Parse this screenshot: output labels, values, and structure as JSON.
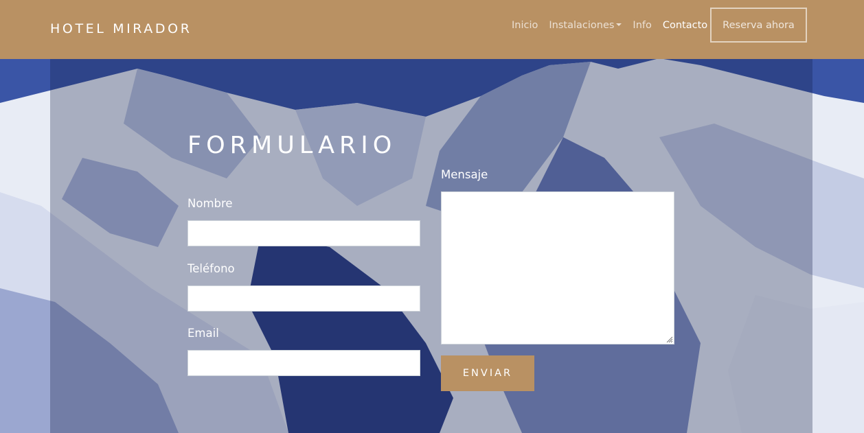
{
  "navbar": {
    "brand": "HOTEL MIRADOR",
    "links": [
      "Inicio",
      "Instalaciones",
      "Info",
      "Contacto"
    ],
    "active_link": "Contacto",
    "reserve_label": "Reserva ahora"
  },
  "form": {
    "title": "FORMULARIO",
    "name_label": "Nombre",
    "name_value": "",
    "phone_label": "Teléfono",
    "phone_value": "",
    "email_label": "Email",
    "email_value": "",
    "message_label": "Mensaje",
    "message_value": "",
    "submit_label": "ENVIAR"
  },
  "colors": {
    "navbar_bg": "#b99163",
    "button_bg": "#b99163",
    "panel_overlay": "rgba(20,30,70,0.30)"
  },
  "icons": {
    "dropdown": "caret-down-icon",
    "textarea_resize": "resize-grip-icon"
  }
}
